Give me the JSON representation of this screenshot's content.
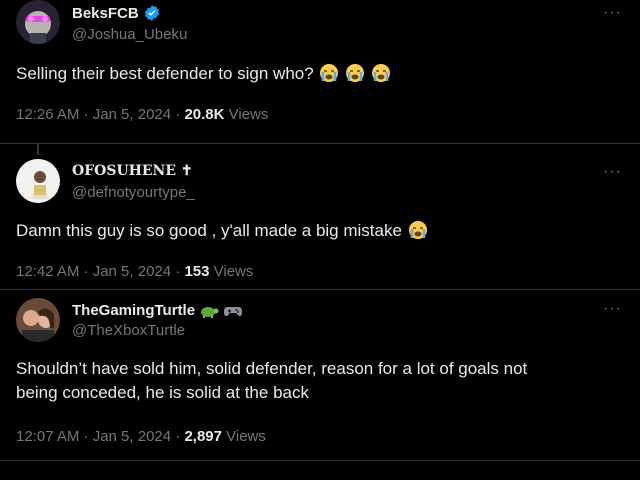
{
  "posts": [
    {
      "name": "BeksFCB",
      "handle": "@Joshua_Ubeku",
      "verified": true,
      "text": "Selling their best defender to sign who?",
      "emojis": [
        "loudly-crying-face",
        "loudly-crying-face",
        "loudly-crying-face"
      ],
      "time": "12:26 AM · Jan 5, 2024 · ",
      "views_count": "20.8K",
      "views_label": " Views"
    },
    {
      "name": "OFOSUHENE ✝",
      "handle": "@defnotyourtype_",
      "text": "Damn this guy is so good , y'all made a big mistake",
      "emojis": [
        "loudly-crying-face"
      ],
      "time": "12:42 AM · Jan 5, 2024 · ",
      "views_count": "153",
      "views_label": " Views"
    },
    {
      "name": "TheGamingTurtle",
      "handle": "@TheXboxTurtle",
      "name_icons": [
        "turtle-icon",
        "gamepad-icon"
      ],
      "text_line1": "Shouldn’t have sold him, solid defender, reason for a lot of goals not",
      "text_line2": "being conceded, he is solid at the back",
      "time": "12:07 AM · Jan 5, 2024 · ",
      "views_count": "2,897",
      "views_label": " Views"
    }
  ],
  "more_label": "···",
  "colors": {
    "background": "#000000",
    "text": "#e7e9ea",
    "muted": "#71767b",
    "verified": "#1d9bf0",
    "divider": "#2f3336"
  }
}
